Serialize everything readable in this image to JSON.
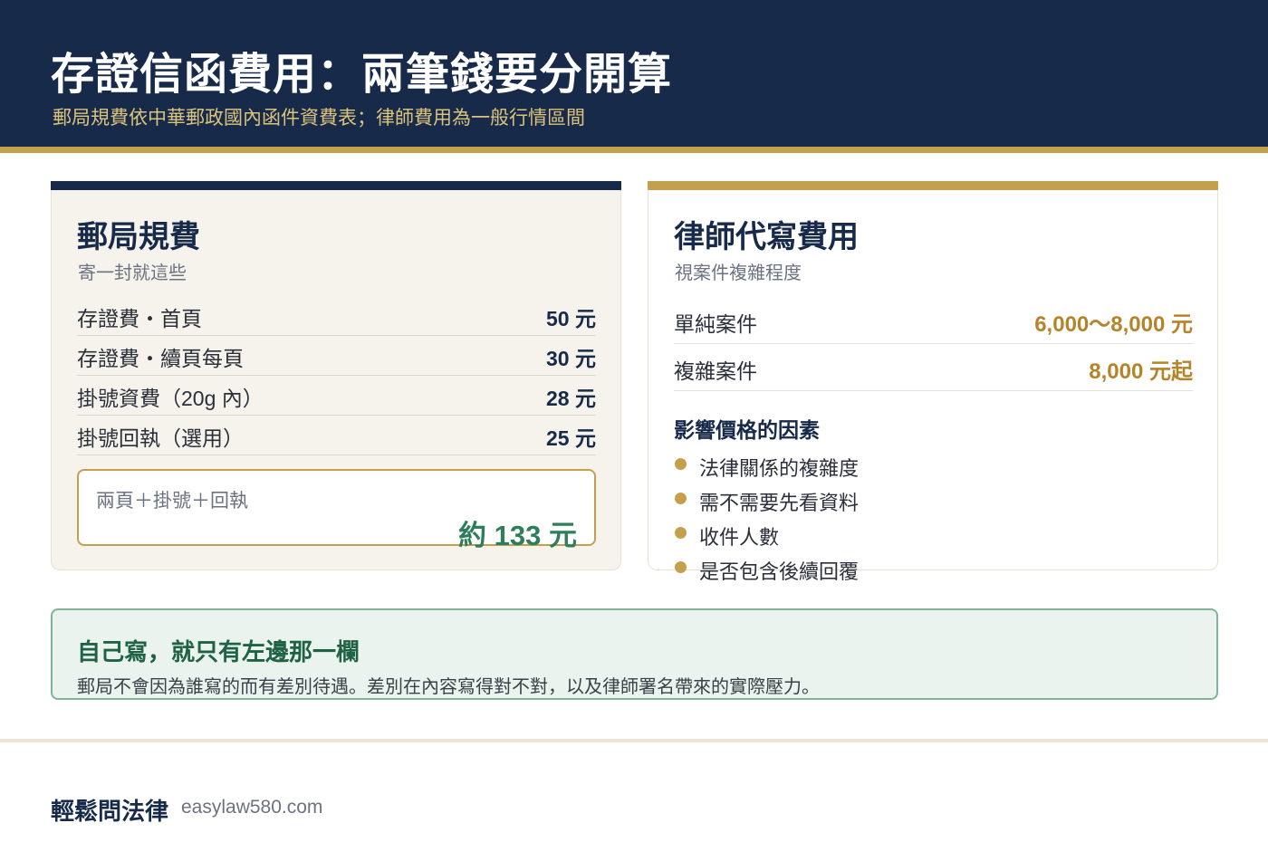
{
  "header": {
    "title": "存證信函費用：兩筆錢要分開算",
    "subtitle": "郵局規費依中華郵政國內函件資費表；律師費用為一般行情區間"
  },
  "post_office": {
    "title": "郵局規費",
    "subtitle": "寄一封就這些",
    "rows": [
      {
        "label": "存證費・首頁",
        "value": "50 元"
      },
      {
        "label": "存證費・續頁每頁",
        "value": "30 元"
      },
      {
        "label": "掛號資費（20g 內）",
        "value": "28 元"
      },
      {
        "label": "掛號回執（選用）",
        "value": "25 元"
      }
    ],
    "total_label": "兩頁＋掛號＋回執",
    "total_value": "約 133 元"
  },
  "lawyer": {
    "title": "律師代寫費用",
    "subtitle": "視案件複雜程度",
    "rows": [
      {
        "label": "單純案件",
        "value": "6,000～8,000 元"
      },
      {
        "label": "複雜案件",
        "value": "8,000 元起"
      }
    ],
    "factors_title": "影響價格的因素",
    "factors": [
      "法律關係的複雜度",
      "需不需要先看資料",
      "收件人數",
      "是否包含後續回覆"
    ]
  },
  "note": {
    "title": "自己寫，就只有左邊那一欄",
    "body": "郵局不會因為誰寫的而有差別待遇。差別在內容寫得對不對，以及律師署名帶來的實際壓力。"
  },
  "footer": {
    "brand": "輕鬆問法律",
    "url": "easylaw580.com"
  },
  "colors": {
    "navy": "#172a4a",
    "gold": "#c4a04c",
    "green": "#2e7d5b"
  }
}
